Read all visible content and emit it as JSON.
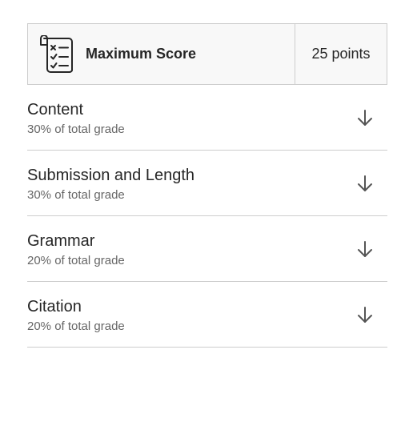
{
  "max_score": {
    "icon": "checklist-icon",
    "title": "Maximum Score",
    "value": "25 points"
  },
  "criteria": [
    {
      "name": "Content",
      "weight": "30% of total grade"
    },
    {
      "name": "Submission and Length",
      "weight": "30% of total grade"
    },
    {
      "name": "Grammar",
      "weight": "20% of total grade"
    },
    {
      "name": "Citation",
      "weight": "20% of total grade"
    }
  ],
  "icons": {
    "expand": "arrow-down-icon"
  },
  "colors": {
    "text": "#262626",
    "muted": "#666666",
    "border": "#cdcdcd",
    "header_bg": "#f8f8f8"
  }
}
